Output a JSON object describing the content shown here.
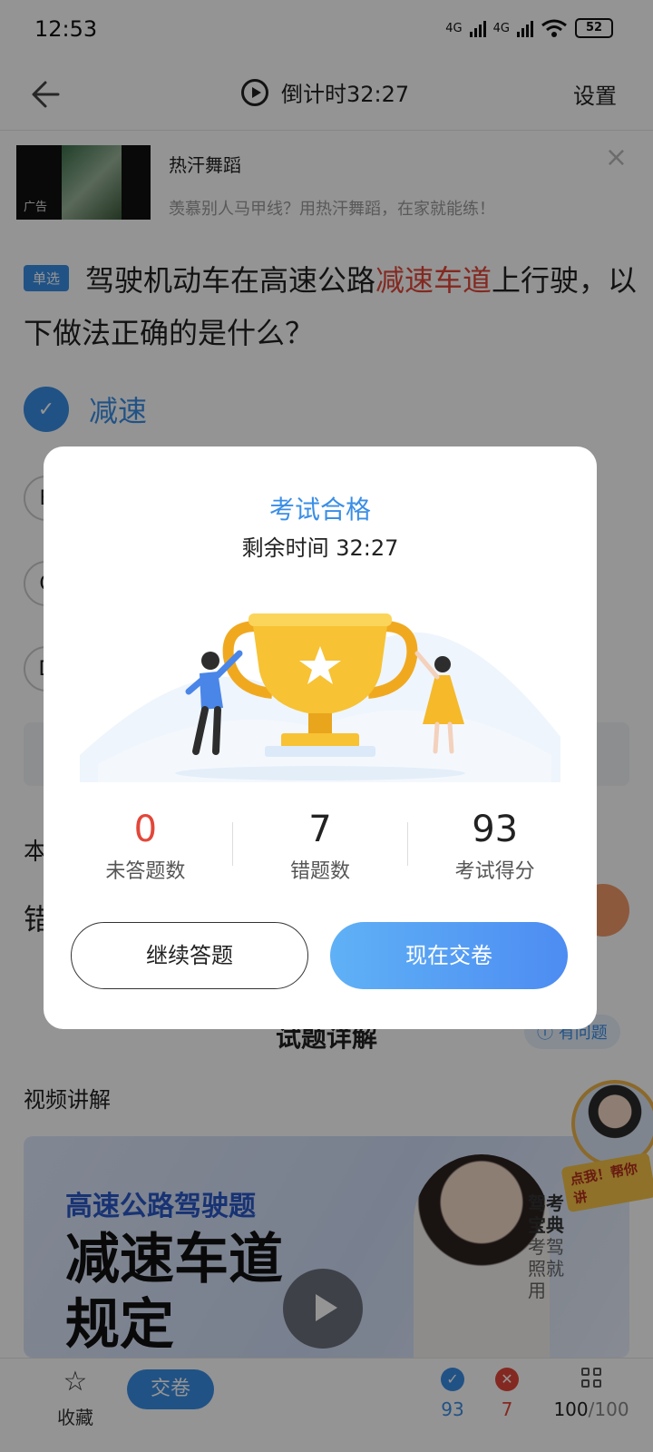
{
  "status_bar": {
    "time": "12:53",
    "network_1": "4G",
    "network_2": "4G",
    "battery": "52"
  },
  "nav": {
    "countdown": "倒计时32:27",
    "settings_label": "设置"
  },
  "ad": {
    "title": "热汗舞蹈",
    "description": "羡慕别人马甲线？用热汗舞蹈，在家就能练！",
    "badge": "广告"
  },
  "question": {
    "type_tag": "单选",
    "text_before": "驾驶机动车在高速公路",
    "text_highlight": "减速车道",
    "text_after": "上行驶，以下做法正确的是什么？",
    "options": [
      {
        "label": "减速",
        "selected": true
      },
      {
        "label": "B",
        "selected": false
      },
      {
        "label": "C",
        "selected": false
      },
      {
        "label": "D",
        "selected": false
      }
    ],
    "partial_line_1": "本",
    "partial_line_2": "错"
  },
  "detail": {
    "title": "试题详解",
    "has_question_btn": "有问题",
    "video_section_label": "视频讲解"
  },
  "video_card": {
    "subtitle": "高速公路驾驶题",
    "title_line1": "减速车道",
    "title_line2": "规定",
    "brand": "驾考宝典",
    "brand_slogan": "考驾照就用"
  },
  "floating_helper": {
    "tag": "点我！帮你讲"
  },
  "bottom_bar": {
    "favorite_label": "收藏",
    "submit_label": "交卷",
    "correct_count": "93",
    "wrong_count": "7",
    "progress": "100",
    "total": "/100"
  },
  "modal": {
    "title": "考试合格",
    "remaining_time": "剩余时间 32:27",
    "stats": [
      {
        "value": "0",
        "label": "未答题数"
      },
      {
        "value": "7",
        "label": "错题数"
      },
      {
        "value": "93",
        "label": "考试得分"
      }
    ],
    "continue_label": "继续答题",
    "submit_now_label": "现在交卷"
  },
  "colors": {
    "accent": "#3a8ee6",
    "wrong": "#e2473a",
    "trophy": "#f5b92a"
  }
}
